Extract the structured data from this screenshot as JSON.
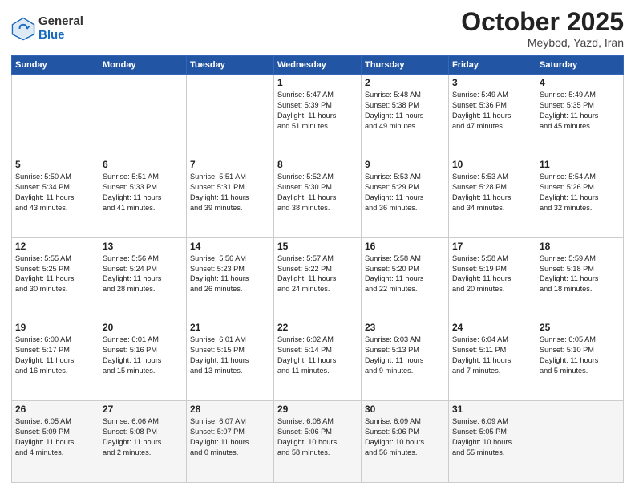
{
  "header": {
    "logo_general": "General",
    "logo_blue": "Blue",
    "month": "October 2025",
    "location": "Meybod, Yazd, Iran"
  },
  "weekdays": [
    "Sunday",
    "Monday",
    "Tuesday",
    "Wednesday",
    "Thursday",
    "Friday",
    "Saturday"
  ],
  "weeks": [
    [
      {
        "day": "",
        "text": ""
      },
      {
        "day": "",
        "text": ""
      },
      {
        "day": "",
        "text": ""
      },
      {
        "day": "1",
        "text": "Sunrise: 5:47 AM\nSunset: 5:39 PM\nDaylight: 11 hours\nand 51 minutes."
      },
      {
        "day": "2",
        "text": "Sunrise: 5:48 AM\nSunset: 5:38 PM\nDaylight: 11 hours\nand 49 minutes."
      },
      {
        "day": "3",
        "text": "Sunrise: 5:49 AM\nSunset: 5:36 PM\nDaylight: 11 hours\nand 47 minutes."
      },
      {
        "day": "4",
        "text": "Sunrise: 5:49 AM\nSunset: 5:35 PM\nDaylight: 11 hours\nand 45 minutes."
      }
    ],
    [
      {
        "day": "5",
        "text": "Sunrise: 5:50 AM\nSunset: 5:34 PM\nDaylight: 11 hours\nand 43 minutes."
      },
      {
        "day": "6",
        "text": "Sunrise: 5:51 AM\nSunset: 5:33 PM\nDaylight: 11 hours\nand 41 minutes."
      },
      {
        "day": "7",
        "text": "Sunrise: 5:51 AM\nSunset: 5:31 PM\nDaylight: 11 hours\nand 39 minutes."
      },
      {
        "day": "8",
        "text": "Sunrise: 5:52 AM\nSunset: 5:30 PM\nDaylight: 11 hours\nand 38 minutes."
      },
      {
        "day": "9",
        "text": "Sunrise: 5:53 AM\nSunset: 5:29 PM\nDaylight: 11 hours\nand 36 minutes."
      },
      {
        "day": "10",
        "text": "Sunrise: 5:53 AM\nSunset: 5:28 PM\nDaylight: 11 hours\nand 34 minutes."
      },
      {
        "day": "11",
        "text": "Sunrise: 5:54 AM\nSunset: 5:26 PM\nDaylight: 11 hours\nand 32 minutes."
      }
    ],
    [
      {
        "day": "12",
        "text": "Sunrise: 5:55 AM\nSunset: 5:25 PM\nDaylight: 11 hours\nand 30 minutes."
      },
      {
        "day": "13",
        "text": "Sunrise: 5:56 AM\nSunset: 5:24 PM\nDaylight: 11 hours\nand 28 minutes."
      },
      {
        "day": "14",
        "text": "Sunrise: 5:56 AM\nSunset: 5:23 PM\nDaylight: 11 hours\nand 26 minutes."
      },
      {
        "day": "15",
        "text": "Sunrise: 5:57 AM\nSunset: 5:22 PM\nDaylight: 11 hours\nand 24 minutes."
      },
      {
        "day": "16",
        "text": "Sunrise: 5:58 AM\nSunset: 5:20 PM\nDaylight: 11 hours\nand 22 minutes."
      },
      {
        "day": "17",
        "text": "Sunrise: 5:58 AM\nSunset: 5:19 PM\nDaylight: 11 hours\nand 20 minutes."
      },
      {
        "day": "18",
        "text": "Sunrise: 5:59 AM\nSunset: 5:18 PM\nDaylight: 11 hours\nand 18 minutes."
      }
    ],
    [
      {
        "day": "19",
        "text": "Sunrise: 6:00 AM\nSunset: 5:17 PM\nDaylight: 11 hours\nand 16 minutes."
      },
      {
        "day": "20",
        "text": "Sunrise: 6:01 AM\nSunset: 5:16 PM\nDaylight: 11 hours\nand 15 minutes."
      },
      {
        "day": "21",
        "text": "Sunrise: 6:01 AM\nSunset: 5:15 PM\nDaylight: 11 hours\nand 13 minutes."
      },
      {
        "day": "22",
        "text": "Sunrise: 6:02 AM\nSunset: 5:14 PM\nDaylight: 11 hours\nand 11 minutes."
      },
      {
        "day": "23",
        "text": "Sunrise: 6:03 AM\nSunset: 5:13 PM\nDaylight: 11 hours\nand 9 minutes."
      },
      {
        "day": "24",
        "text": "Sunrise: 6:04 AM\nSunset: 5:11 PM\nDaylight: 11 hours\nand 7 minutes."
      },
      {
        "day": "25",
        "text": "Sunrise: 6:05 AM\nSunset: 5:10 PM\nDaylight: 11 hours\nand 5 minutes."
      }
    ],
    [
      {
        "day": "26",
        "text": "Sunrise: 6:05 AM\nSunset: 5:09 PM\nDaylight: 11 hours\nand 4 minutes."
      },
      {
        "day": "27",
        "text": "Sunrise: 6:06 AM\nSunset: 5:08 PM\nDaylight: 11 hours\nand 2 minutes."
      },
      {
        "day": "28",
        "text": "Sunrise: 6:07 AM\nSunset: 5:07 PM\nDaylight: 11 hours\nand 0 minutes."
      },
      {
        "day": "29",
        "text": "Sunrise: 6:08 AM\nSunset: 5:06 PM\nDaylight: 10 hours\nand 58 minutes."
      },
      {
        "day": "30",
        "text": "Sunrise: 6:09 AM\nSunset: 5:06 PM\nDaylight: 10 hours\nand 56 minutes."
      },
      {
        "day": "31",
        "text": "Sunrise: 6:09 AM\nSunset: 5:05 PM\nDaylight: 10 hours\nand 55 minutes."
      },
      {
        "day": "",
        "text": ""
      }
    ]
  ]
}
